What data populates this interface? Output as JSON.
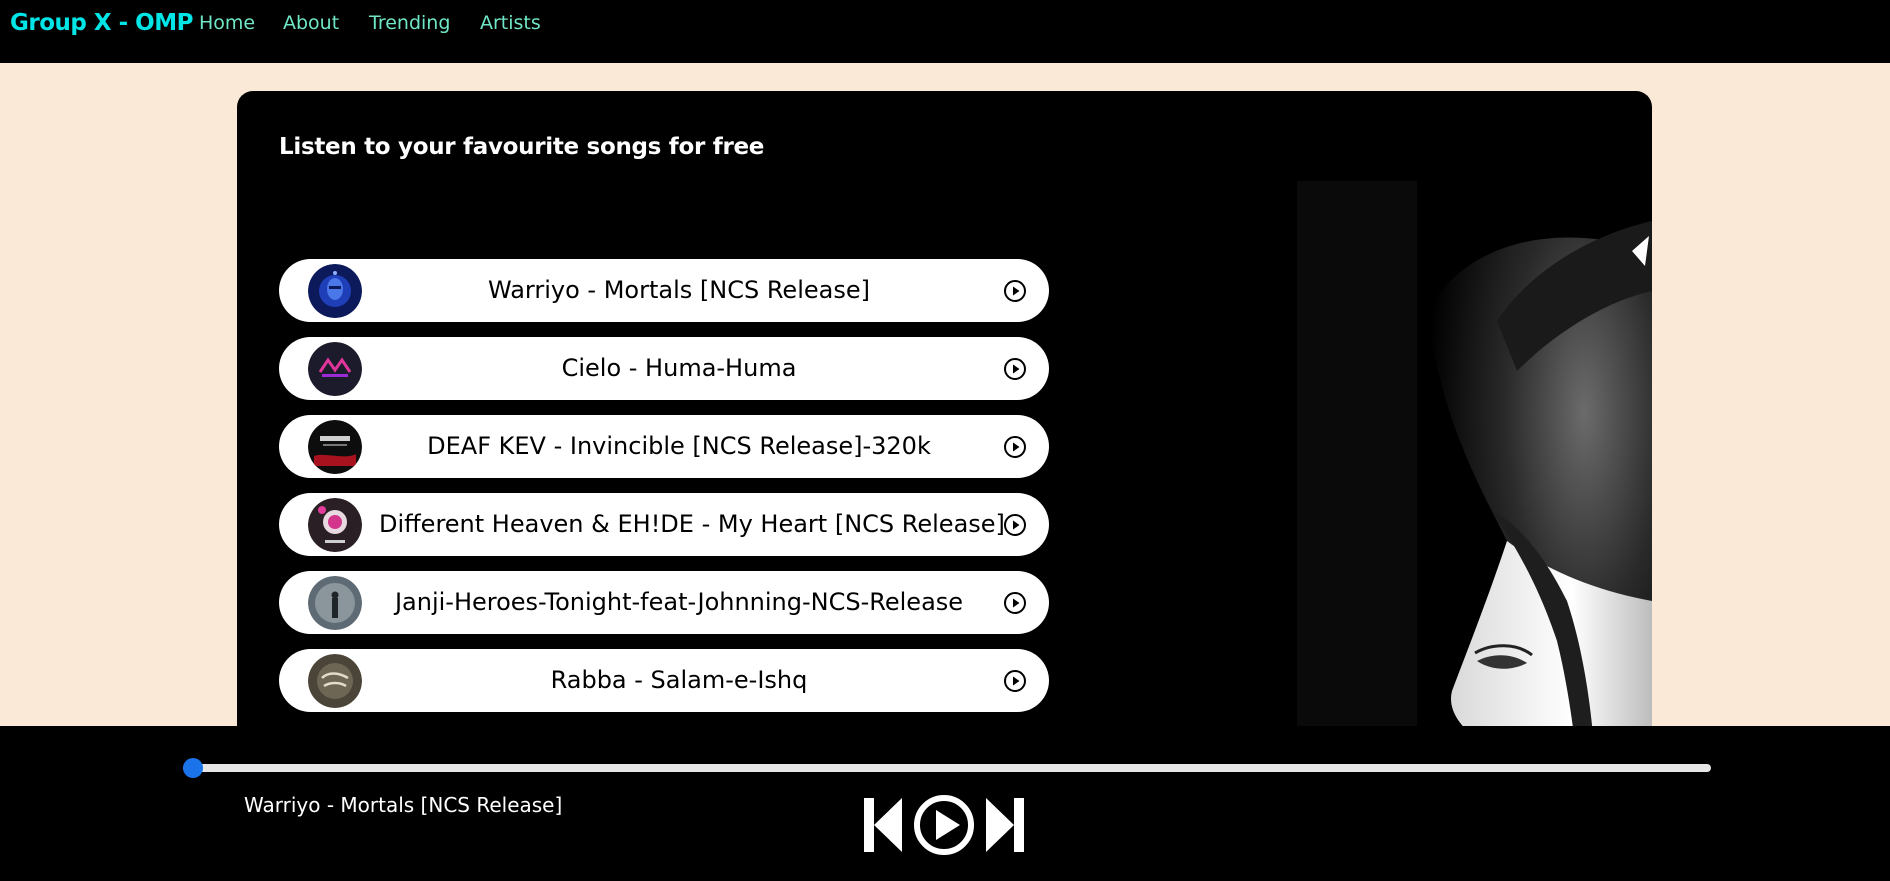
{
  "navbar": {
    "brand": "Group X - OMP",
    "links": [
      {
        "label": "Home"
      },
      {
        "label": "About"
      },
      {
        "label": "Trending"
      },
      {
        "label": "Artists"
      }
    ],
    "brand_color": "#00e5e5",
    "link_color": "#6fe7c7"
  },
  "main": {
    "heading": "Listen to your favourite songs for free",
    "songs": [
      {
        "title": "Warriyo - Mortals [NCS Release]",
        "thumb": "album-cover-blue-face"
      },
      {
        "title": "Cielo - Huma-Huma",
        "thumb": "album-cover-neon-pink"
      },
      {
        "title": "DEAF KEV - Invincible [NCS Release]-320k",
        "thumb": "album-cover-red-black"
      },
      {
        "title": "Different Heaven & EH!DE - My Heart [NCS Release]",
        "thumb": "album-cover-pink-astronaut"
      },
      {
        "title": "Janji-Heroes-Tonight-feat-Johnning-NCS-Release",
        "thumb": "album-cover-grey-figure"
      },
      {
        "title": "Rabba - Salam-e-Ishq",
        "thumb": "album-cover-sepia"
      }
    ]
  },
  "player": {
    "now_playing": "Warriyo - Mortals [NCS Release]",
    "progress": 0.0,
    "accent": "#1a73e8"
  },
  "colors": {
    "page_background": "#fbe9d7",
    "card_background": "#000000"
  }
}
